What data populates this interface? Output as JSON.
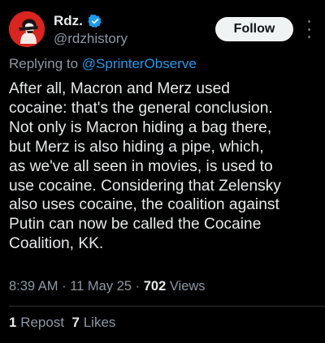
{
  "author": {
    "display_name": "Rdz.",
    "handle": "@rdzhistory",
    "verified": true
  },
  "follow_button": {
    "label": "Follow"
  },
  "reply_context": {
    "prefix": "Replying to ",
    "mention": "@SprinterObserve"
  },
  "tweet": {
    "lines": [
      "After all, Macron and Merz used",
      "cocaine: that's the general conclusion.",
      "Not only is Macron hiding a bag there,",
      "but Merz is also hiding a pipe, which,",
      "as we've all seen in movies, is used to",
      "use cocaine. Considering that Zelensky",
      "also uses cocaine, the coalition against",
      "Putin can now be called the Cocaine",
      "Coalition, KK."
    ]
  },
  "meta": {
    "time": "8:39 AM",
    "separator": " · ",
    "date": "11 May 25",
    "views_count": "702",
    "views_label": " Views"
  },
  "stats": {
    "reposts_count": "1",
    "reposts_label": " Repost",
    "likes_count": "7",
    "likes_label": " Likes"
  },
  "colors": {
    "background": "#000000",
    "text": "#e7e9ea",
    "secondary": "#8b98a5",
    "link": "#1d9bf0",
    "avatar_bg": "#d9241f",
    "verified_badge": "#1d9bf0"
  },
  "icons": [
    "avatar-image",
    "verified-badge-icon",
    "more-options-icon"
  ]
}
